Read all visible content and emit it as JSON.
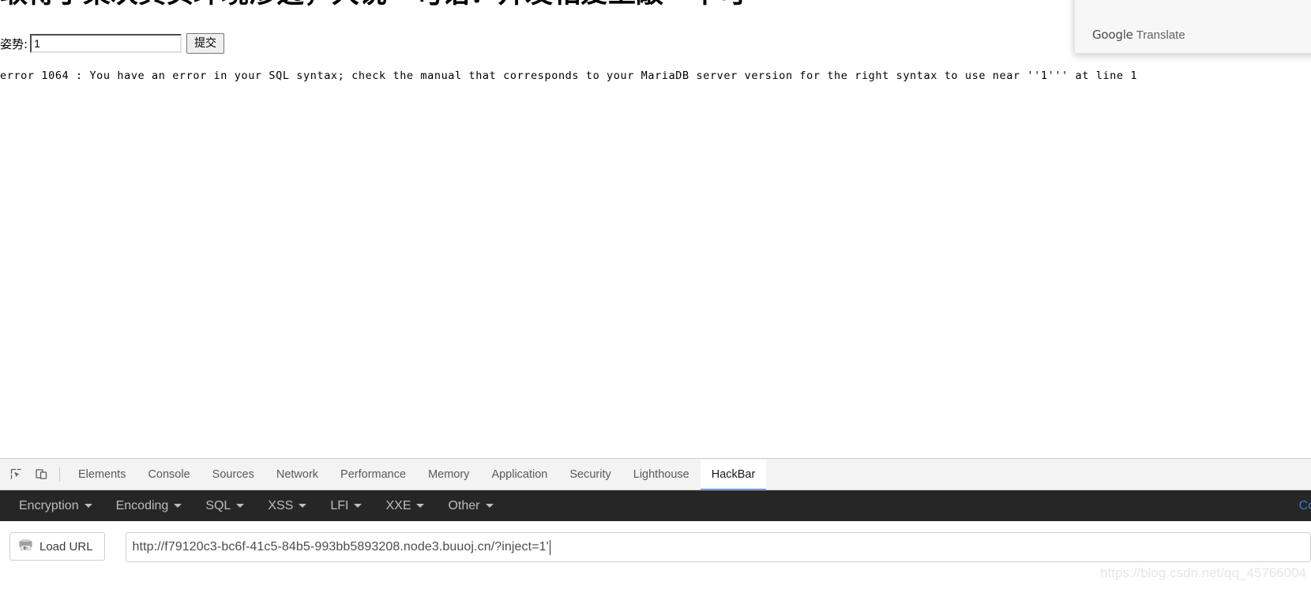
{
  "page": {
    "heading": "取得于某次真实环境渗透，大说一句话：开发相爱上敲一不可",
    "form": {
      "label": "姿势:",
      "input_value": "1",
      "input_placeholder": "",
      "submit_label": "提交"
    },
    "error_text": "error 1064 : You have an error in your SQL syntax; check the manual that corresponds to your MariaDB server version for the right syntax to use near ''1''' at line 1"
  },
  "translate_popup": {
    "brand": "Google",
    "word": "Translate"
  },
  "devtools": {
    "icons": {
      "inspect": "inspect-element-icon",
      "device": "device-toolbar-icon"
    },
    "tabs": [
      {
        "label": "Elements",
        "active": false
      },
      {
        "label": "Console",
        "active": false
      },
      {
        "label": "Sources",
        "active": false
      },
      {
        "label": "Network",
        "active": false
      },
      {
        "label": "Performance",
        "active": false
      },
      {
        "label": "Memory",
        "active": false
      },
      {
        "label": "Application",
        "active": false
      },
      {
        "label": "Security",
        "active": false
      },
      {
        "label": "Lighthouse",
        "active": false
      },
      {
        "label": "HackBar",
        "active": true
      }
    ]
  },
  "hackbar": {
    "menus": [
      {
        "label": "Encryption"
      },
      {
        "label": "Encoding"
      },
      {
        "label": "SQL"
      },
      {
        "label": "XSS"
      },
      {
        "label": "LFI"
      },
      {
        "label": "XXE"
      },
      {
        "label": "Other"
      }
    ],
    "right_link": "Con",
    "load_url_label": "Load URL",
    "load_url_icon": "load-url-icon",
    "url_value": "http://f79120c3-bc6f-41c5-84b5-993bb5893208.node3.buuoj.cn/?inject=1'"
  },
  "watermark": {
    "text": "https://blog.csdn.net/qq_45766004"
  },
  "colors": {
    "accent": "#1a73e8",
    "hackbar_bg": "#262626",
    "hackbar_link": "#2d7fd3",
    "devtools_tabbar": "#f3f3f3"
  }
}
